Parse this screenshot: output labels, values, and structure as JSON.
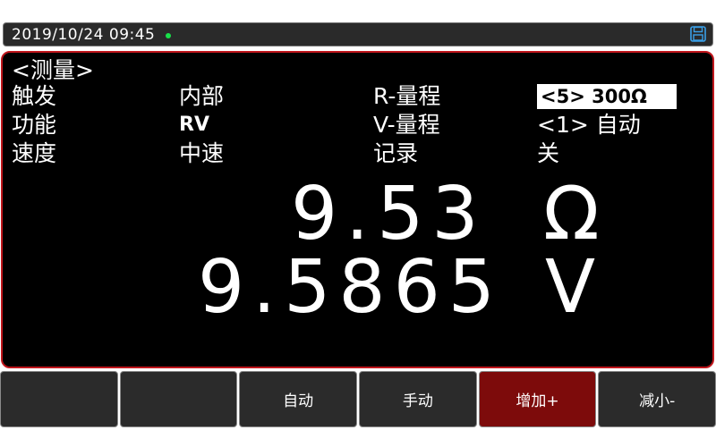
{
  "status": {
    "datetime": "2019/10/24  09:45",
    "indicator_color": "#18e24a",
    "save_icon": "floppy-save-icon"
  },
  "measure": {
    "title": "<测量>",
    "params": [
      {
        "label": "触发",
        "value": "内部"
      },
      {
        "label": "功能",
        "value": "RV"
      },
      {
        "label": "速度",
        "value": "中速"
      }
    ],
    "params_right": [
      {
        "label": "R-量程",
        "value": "<5>  300Ω"
      },
      {
        "label": "V-量程",
        "value": "<1>  自动"
      },
      {
        "label": "记录",
        "value": "关"
      }
    ],
    "resistance": {
      "value": "9.53",
      "unit": "Ω"
    },
    "voltage": {
      "value": "9.5865",
      "unit": "V"
    }
  },
  "softkeys": [
    {
      "label": ""
    },
    {
      "label": ""
    },
    {
      "label": "自动"
    },
    {
      "label": "手动"
    },
    {
      "label": "增加+"
    },
    {
      "label": "减小-"
    }
  ],
  "colors": {
    "panel_border": "#c0161c",
    "active_key": "#7d0b0b",
    "background": "#000000"
  }
}
